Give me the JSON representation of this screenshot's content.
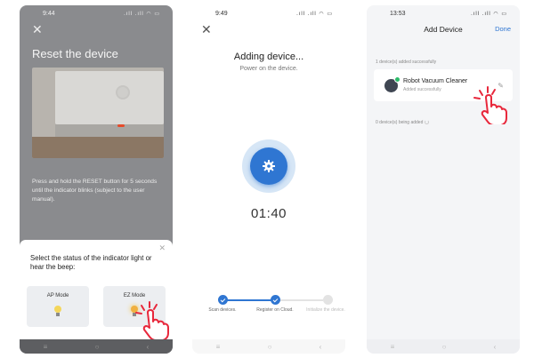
{
  "phone1": {
    "time": "9:44",
    "status_icons": "ð¶ .ıll .ıll ◠ ▭",
    "title": "Reset the device",
    "instruction": "Press and hold the RESET button for 5 seconds until the indicator blinks (subject to the user manual).",
    "sheet_title": "Select the status of the indicator light or hear the beep:",
    "ap_mode": "AP Mode",
    "ez_mode": "EZ Mode"
  },
  "phone2": {
    "time": "9:49",
    "status_icons": ".ıll .ıll ◠ ▭",
    "title": "Adding device...",
    "subtitle": "Power on the device.",
    "timer": "01:40",
    "steps": [
      {
        "label": "Scan devices.",
        "state": "done"
      },
      {
        "label": "Register on Cloud.",
        "state": "done"
      },
      {
        "label": "Initialize the device.",
        "state": "todo"
      }
    ]
  },
  "phone3": {
    "time": "13:53",
    "status_icons": ".ıll .ıll ◠ ▭",
    "title": "Add Device",
    "done": "Done",
    "added_section": "1 device(s) added successfully",
    "device_name": "Robot Vacuum Cleaner",
    "device_status": "Added successfully",
    "adding_section": "0 device(s) being added"
  },
  "nav": {
    "menu": "≡",
    "home": "○",
    "back": "‹"
  },
  "colors": {
    "accent": "#2f76d2",
    "success": "#2ebb6a",
    "tap": "#e8283c"
  }
}
